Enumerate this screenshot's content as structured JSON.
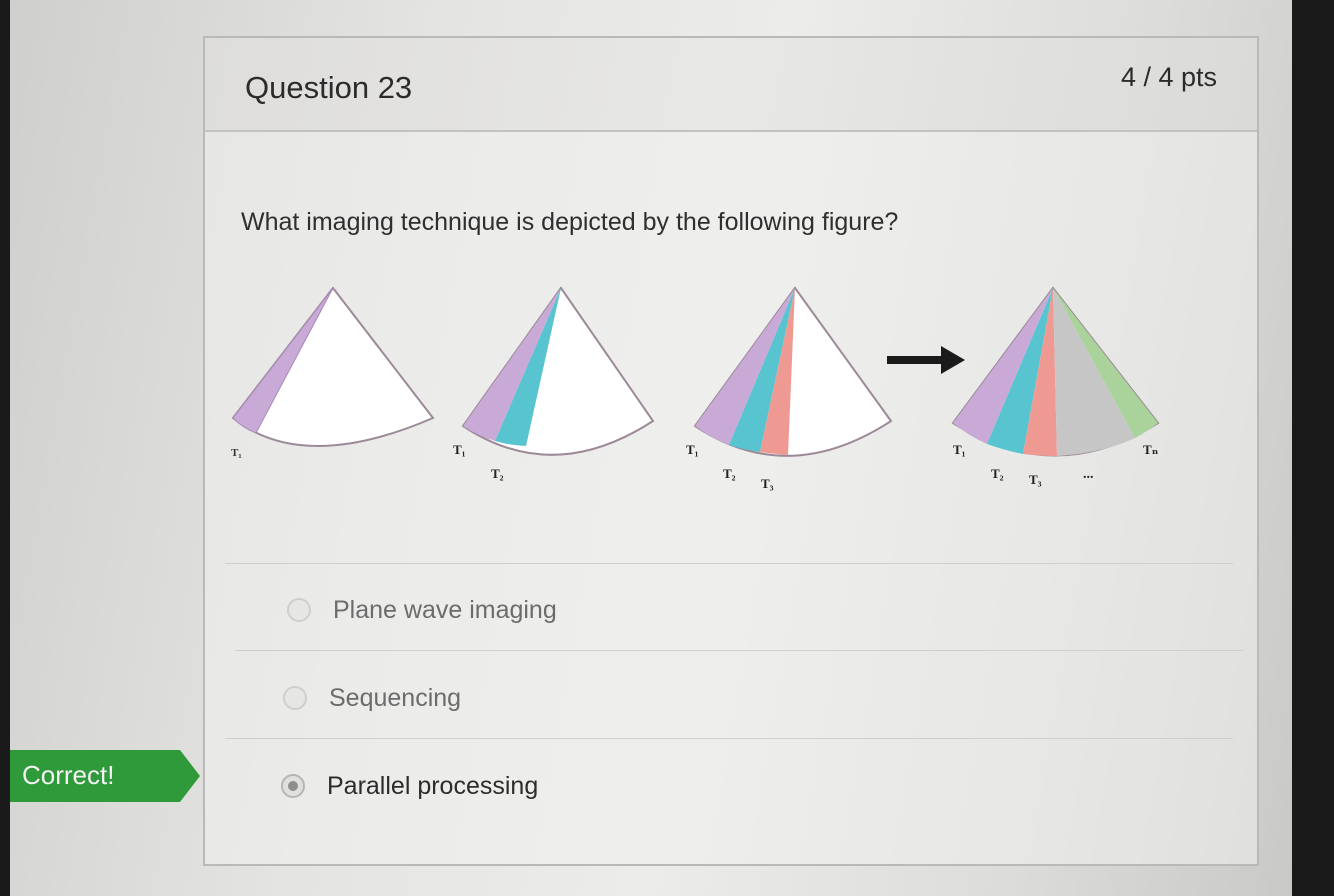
{
  "question": {
    "title": "Question 23",
    "points": "4 / 4 pts",
    "text": "What imaging technique is depicted by the following figure?"
  },
  "figure": {
    "labels": {
      "t1": "T₁",
      "t2": "T₂",
      "t3": "T₃",
      "tn": "Tₙ",
      "ellipsis": "..."
    },
    "colors": {
      "purple": "#c9a9d6",
      "cyan": "#58c4cf",
      "salmon": "#ee9a92",
      "gray": "#c6c6c6",
      "green": "#a9d39a",
      "arrow": "#1a1a1a"
    }
  },
  "answers": [
    {
      "label": "Plane wave imaging",
      "selected": false
    },
    {
      "label": "Sequencing",
      "selected": false
    },
    {
      "label": "Parallel processing",
      "selected": true
    }
  ],
  "feedback": {
    "label": "Correct!",
    "color": "#2f9a3a"
  }
}
